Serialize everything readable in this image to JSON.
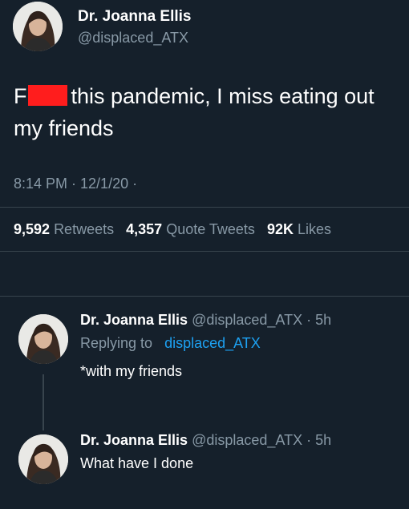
{
  "main_tweet": {
    "author_name": "Dr. Joanna Ellis",
    "author_handle": "@displaced_ATX",
    "text_prefix": "F",
    "text_after_censor": "this pandemic, I miss eating out my friends",
    "censor_color": "#ff1d1d",
    "timestamp": "8:14 PM · 12/1/20 ·",
    "stats": {
      "retweets_count": "9,592",
      "retweets_label": "Retweets",
      "quotes_count": "4,357",
      "quotes_label": "Quote Tweets",
      "likes_count": "92K",
      "likes_label": "Likes"
    }
  },
  "replies": [
    {
      "author_name": "Dr. Joanna Ellis",
      "meta": "@displaced_ATX · 5h",
      "replying_label": "Replying to",
      "replying_to": "displaced_ATX",
      "text": "*with my friends"
    },
    {
      "author_name": "Dr. Joanna Ellis",
      "meta": "@displaced_ATX · 5h",
      "text": "What have I done"
    }
  ],
  "colors": {
    "background": "#15202b",
    "muted_text": "#8899a6",
    "link": "#1da1f2",
    "divider": "#38444d"
  }
}
